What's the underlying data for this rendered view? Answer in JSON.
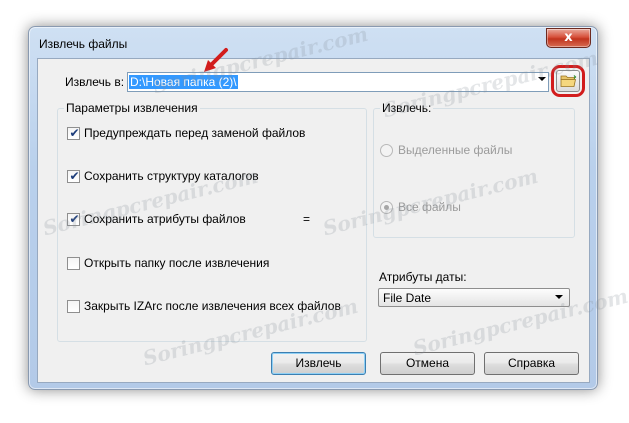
{
  "dialog": {
    "title": "Извлечь файлы",
    "close_glyph": "x"
  },
  "extract_to": {
    "label": "Извлечь в:",
    "path_value": "D:\\Новая папка (2)\\"
  },
  "options_group": {
    "title": "Параметры извлечения",
    "items": [
      {
        "label": "Предупреждать перед заменой файлов",
        "checked": true
      },
      {
        "label": "Сохранить структуру каталогов",
        "checked": true
      },
      {
        "label": "Сохранить атрибуты файлов",
        "checked": true,
        "suffix": "="
      },
      {
        "label": "Открыть папку после извлечения",
        "checked": false
      },
      {
        "label": "Закрыть IZArc после извлечения всех файлов",
        "checked": false
      }
    ]
  },
  "extract_group": {
    "title": "Извлечь:",
    "options": [
      {
        "label": "Выделенные файлы",
        "selected": false
      },
      {
        "label": "Все файлы",
        "selected": true
      }
    ]
  },
  "date_attributes": {
    "label": "Атрибуты даты:",
    "selected": "File Date"
  },
  "buttons": {
    "extract": "Извлечь",
    "cancel": "Отмена",
    "help": "Справка"
  },
  "watermark_text": "Soringpcrepair.com",
  "colors": {
    "highlight": "#d21c1c",
    "selection": "#3399ff",
    "default_button_border": "#3c7fb1"
  },
  "icons": {
    "folder": "folder-open-icon",
    "annotation": "red-arrow-icon"
  }
}
